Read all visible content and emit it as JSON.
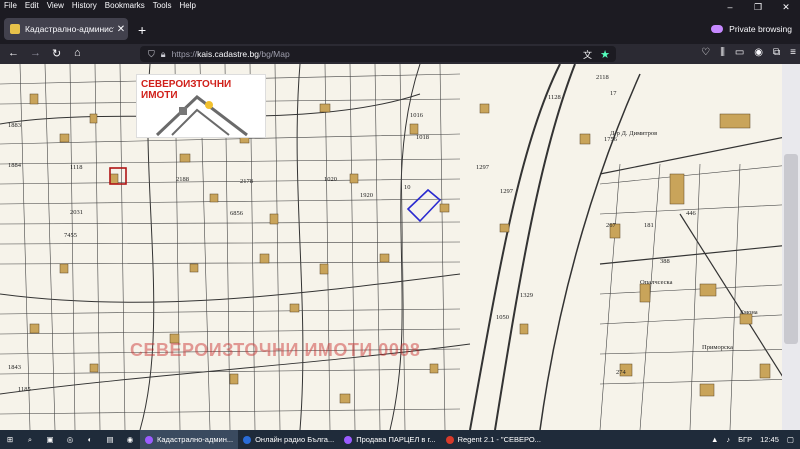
{
  "menu": [
    "File",
    "Edit",
    "View",
    "History",
    "Bookmarks",
    "Tools",
    "Help"
  ],
  "window": {
    "minimize": "–",
    "restore": "❐",
    "close": "✕"
  },
  "tab": {
    "title": "Кадастрално-административ",
    "close": "✕"
  },
  "new_tab": "+",
  "private_label": "Private browsing",
  "url": {
    "protocol": "https://",
    "host": "kais.cadastre.bg",
    "path": "/bg/Map"
  },
  "nav": {
    "back": "←",
    "forward": "→",
    "reload": "↻",
    "home": "⌂"
  },
  "map": {
    "logo_text": "СЕВЕРОИЗТОЧНИ ИМОТИ",
    "watermark": "СЕВЕРОИЗТОЧНИ ИМОТИ 0008",
    "labels": [
      {
        "t": "1128"
      },
      {
        "t": "2118"
      },
      {
        "t": "1016"
      },
      {
        "t": "1297"
      },
      {
        "t": "1756"
      },
      {
        "t": "1883"
      },
      {
        "t": "2031"
      },
      {
        "t": "7455"
      },
      {
        "t": "1020"
      },
      {
        "t": "1050"
      },
      {
        "t": "1329"
      },
      {
        "t": "1843"
      },
      {
        "t": "1185"
      },
      {
        "t": "274"
      },
      {
        "t": "267"
      },
      {
        "t": "181"
      },
      {
        "t": "446"
      },
      {
        "t": "388"
      },
      {
        "t": "2188"
      },
      {
        "t": "6856"
      },
      {
        "t": "1018"
      },
      {
        "t": "1920"
      },
      {
        "t": "1297"
      },
      {
        "t": "1884"
      },
      {
        "t": "1118"
      },
      {
        "t": "2178"
      },
      {
        "t": "17"
      },
      {
        "t": "10"
      }
    ],
    "poi": [
      "Опалчсеска",
      "Емона",
      "Приморска",
      "Д-р Д. Димитров"
    ]
  },
  "taskbar": {
    "tasks": [
      {
        "label": "Кадастрално-админ..."
      },
      {
        "label": "Онлайн радио Бълга..."
      },
      {
        "label": "Продава ПАРЦЕЛ в г..."
      },
      {
        "label": "Regent 2.1 - \"СЕВЕРО..."
      }
    ],
    "lang": "БГР",
    "time": "12:45"
  }
}
